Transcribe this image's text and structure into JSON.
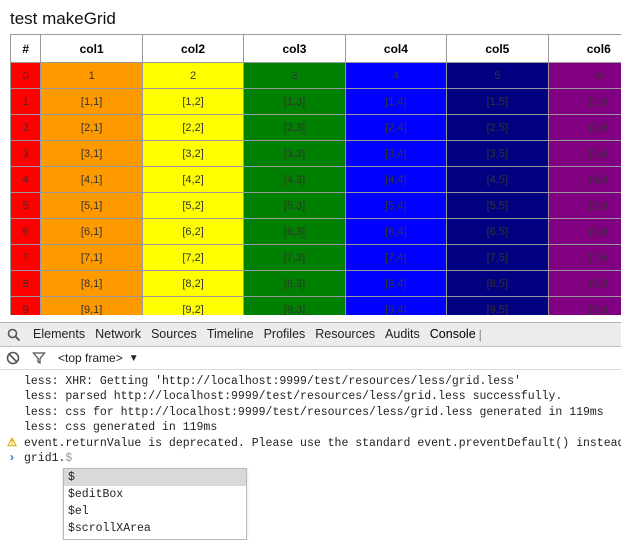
{
  "page": {
    "title": "test makeGrid"
  },
  "grid": {
    "headers": [
      "#",
      "col1",
      "col2",
      "col3",
      "col4",
      "col5",
      "col6"
    ],
    "row_colors": [
      "#ff0000",
      "#ff9900",
      "#ffff00",
      "#008000",
      "#0000ff",
      "#000080",
      "#800080"
    ],
    "rows": [
      [
        "0",
        "1",
        "2",
        "3",
        "4",
        "5",
        "6"
      ],
      [
        "1",
        "[1,1]",
        "[1,2]",
        "[1,3]",
        "[1,4]",
        "[1,5]",
        "[1,6"
      ],
      [
        "2",
        "[2,1]",
        "[2,2]",
        "[2,3]",
        "[2,4]",
        "[2,5]",
        "[2,6"
      ],
      [
        "3",
        "[3,1]",
        "[3,2]",
        "[3,3]",
        "[3,4]",
        "[3,5]",
        "[3,6"
      ],
      [
        "4",
        "[4,1]",
        "[4,2]",
        "[4,3]",
        "[4,4]",
        "[4,5]",
        "[4,6"
      ],
      [
        "5",
        "[5,1]",
        "[5,2]",
        "[5,3]",
        "[5,4]",
        "[5,5]",
        "[5,6"
      ],
      [
        "6",
        "[6,1]",
        "[6,2]",
        "[6,3]",
        "[6,4]",
        "[6,5]",
        "[6,6"
      ],
      [
        "7",
        "[7,1]",
        "[7,2]",
        "[7,3]",
        "[7,4]",
        "[7,5]",
        "[7,6"
      ],
      [
        "8",
        "[8,1]",
        "[8,2]",
        "[8,3]",
        "[8,4]",
        "[8,5]",
        "[8,6"
      ],
      [
        "9",
        "[9,1]",
        "[9,2]",
        "[9,3]",
        "[9,4]",
        "[9,5]",
        "[9,6"
      ]
    ]
  },
  "devtools": {
    "tabs": [
      "Elements",
      "Network",
      "Sources",
      "Timeline",
      "Profiles",
      "Resources",
      "Audits",
      "Console"
    ],
    "active_tab": "Console",
    "frame_selector": "<top frame>",
    "console_lines": [
      {
        "type": "log",
        "text": "less: XHR: Getting 'http://localhost:9999/test/resources/less/grid.less'"
      },
      {
        "type": "log",
        "text": "less: parsed http://localhost:9999/test/resources/less/grid.less successfully."
      },
      {
        "type": "log",
        "text": "less: css for http://localhost:9999/test/resources/less/grid.less generated in 119ms"
      },
      {
        "type": "log",
        "text": "less: css generated in 119ms"
      },
      {
        "type": "warning",
        "text": "event.returnValue is deprecated. Please use the standard event.preventDefault() instead."
      }
    ],
    "prompt_input": "grid1.",
    "prompt_suggestion": "$",
    "autocomplete": [
      "$",
      "$editBox",
      "$el",
      "$scrollXArea"
    ]
  }
}
